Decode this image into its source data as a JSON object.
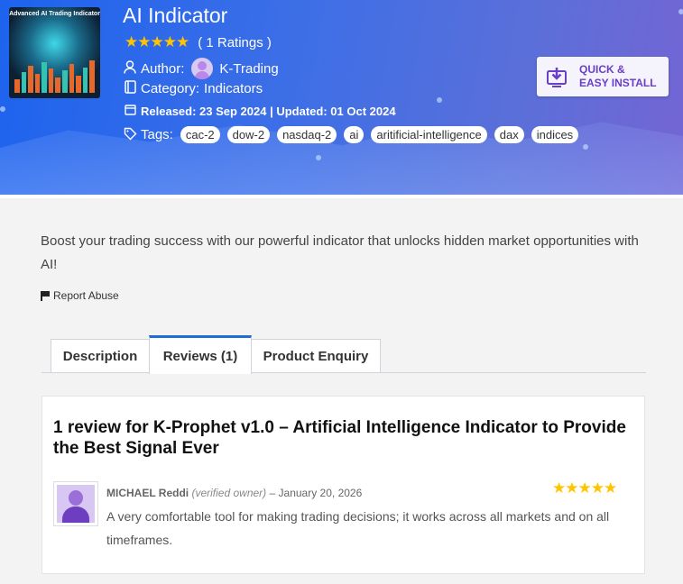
{
  "product": {
    "title": "AI Indicator",
    "thumbnail_text": "Advanced AI Trading Indicator",
    "stars": "★★★★★",
    "rating_text": "( 1 Ratings )",
    "author_label": "Author:",
    "author_name": "K-Trading",
    "category_label": "Category:",
    "category_value": "Indicators",
    "dates": "Released: 23 Sep 2024 | Updated: 01 Oct 2024",
    "tags_label": "Tags:",
    "tags": [
      "cac-2",
      "dow-2",
      "nasdaq-2",
      "ai",
      "aritificial-intelligence",
      "dax",
      "indices"
    ]
  },
  "install_button": {
    "line1": "QUICK &",
    "line2": "EASY INSTALL"
  },
  "description": "Boost your trading success with our powerful indicator that unlocks hidden market opportunities with AI!",
  "report_abuse": "Report Abuse",
  "tabs": [
    {
      "label": "Description",
      "active": false
    },
    {
      "label": "Reviews (1)",
      "active": true
    },
    {
      "label": "Product Enquiry",
      "active": false
    }
  ],
  "reviews": {
    "heading": "1 review for K-Prophet v1.0 – Artificial Intelligence Indicator to Provide the Best Signal Ever",
    "items": [
      {
        "author": "MICHAEL Reddi",
        "verified": "(verified owner)",
        "date": "– January 20, 2026",
        "stars": "★★★★★",
        "text": "A very comfortable tool for making trading decisions; it works across all markets and on all timeframes."
      }
    ]
  },
  "colors": {
    "accent": "#1f6ed4",
    "star": "#ffc400",
    "install_text": "#6a3fc7"
  }
}
